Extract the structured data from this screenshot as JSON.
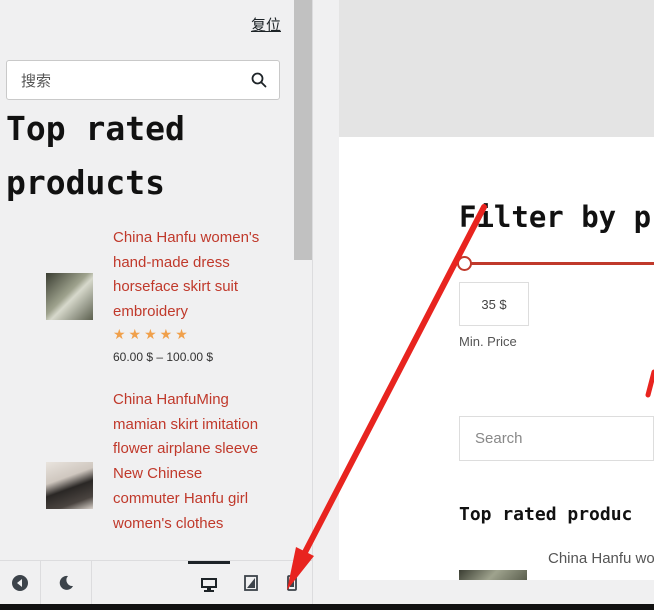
{
  "panel": {
    "reset_label": "复位",
    "search": {
      "placeholder": "搜索"
    },
    "widget_title": "Top rated products",
    "products": [
      {
        "title": "China Hanfu women's hand-made dress horseface skirt suit embroidery",
        "stars": "★★★★★",
        "rating": 5,
        "price": "60.00 $ – 100.00 $"
      },
      {
        "title": "China HanfuMing mamian skirt imitation flower airplane sleeve New Chinese commuter Hanfu girl women's clothes"
      }
    ]
  },
  "footer": {
    "icons": [
      "collapse-icon",
      "dark-mode-icon",
      "desktop-icon",
      "tablet-icon",
      "mobile-icon"
    ]
  },
  "preview": {
    "filter_title": "Filter by p",
    "min_price_value": "35 $",
    "min_price_label": "Min. Price",
    "search_placeholder": "Search",
    "top_rated_title": "Top rated produc",
    "product_title_partial": "China Hanfu wo"
  },
  "colors": {
    "accent": "#c0392b",
    "star": "#f0a04b",
    "annotation_arrow": "#e8241f"
  }
}
